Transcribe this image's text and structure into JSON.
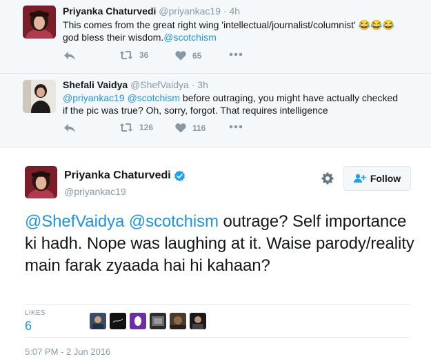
{
  "thread": [
    {
      "name": "Priyanka Chaturvedi",
      "handle": "@priyankac19",
      "sep": "·",
      "time": "4h",
      "text_line1": "This comes from the great right wing 'intellectual/journalist/columnist' 😂😂😂",
      "text_line2_plain": "god bless their wisdom.",
      "text_line2_link": "@scotchism",
      "retweets": "36",
      "likes": "65"
    },
    {
      "name": "Shefali Vaidya",
      "handle": "@ShefVaidya",
      "sep": "·",
      "time": "3h",
      "text_link1": "@priyankac19",
      "text_link2": "@scotchism",
      "text_line1_rest": " before outraging, you might have actually checked",
      "text_line2": "if the pic was true? Oh, sorry, forgot. That requires intelligence",
      "retweets": "126",
      "likes": "116"
    }
  ],
  "main_tweet": {
    "name": "Priyanka Chaturvedi",
    "handle": "@priyankac19",
    "follow_label": "Follow",
    "mention1": "@ShefVaidya",
    "mention2": "@scotchism",
    "text_rest": " outrage? Self importance ki hadh. Nope was laughing at it. Waise parody/reality main farak zyaada hai hi kahaan?",
    "likes_label": "LIKES",
    "likes_count": "6",
    "timestamp": "5:07 PM - 2 Jun 2016"
  },
  "icons": [
    "reply-icon",
    "retweet-icon",
    "heart-icon",
    "more-icon",
    "verified-icon",
    "gear-icon",
    "follow-icon"
  ],
  "colors": {
    "link": "#1b95e0",
    "muted": "#8899a6",
    "thread_bg": "#f5f8fa",
    "divider": "#e1e8ed"
  }
}
